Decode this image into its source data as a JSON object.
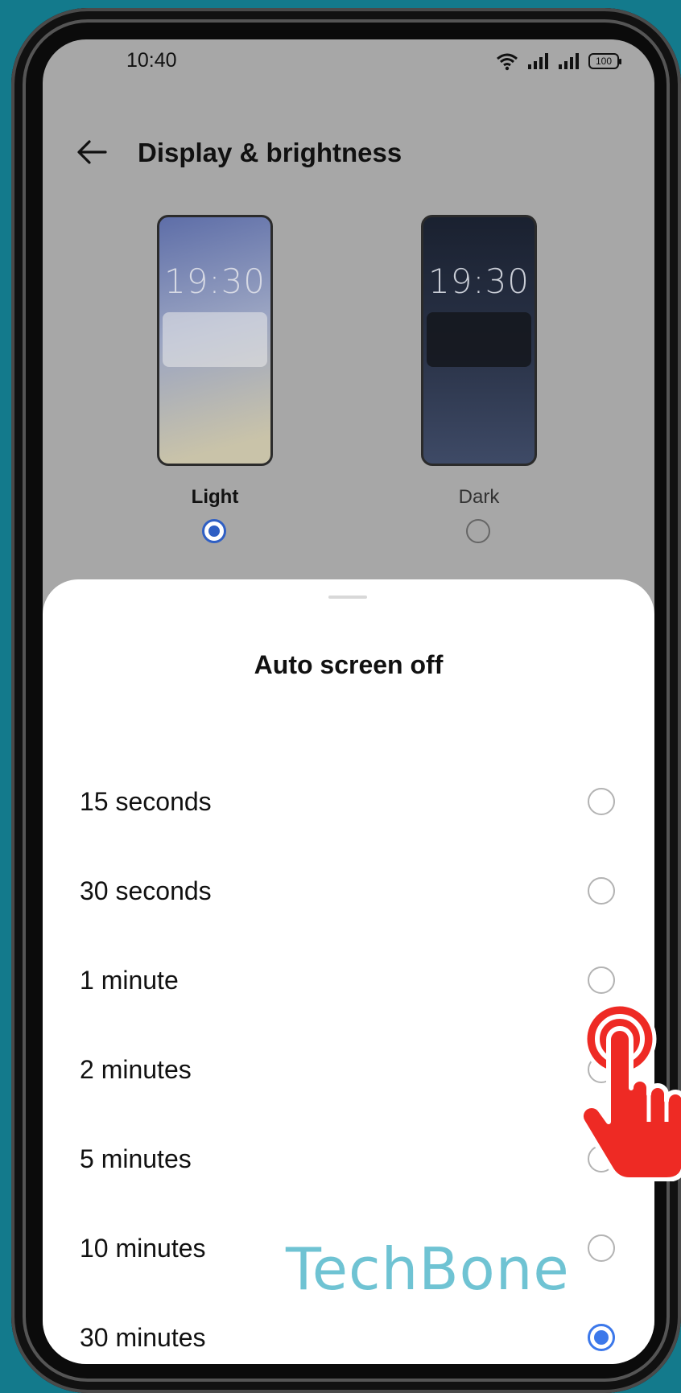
{
  "status_bar": {
    "time": "10:40",
    "battery": "100"
  },
  "header": {
    "title": "Display & brightness"
  },
  "themes": {
    "light": {
      "clock": "19:30",
      "label": "Light",
      "selected": true
    },
    "dark": {
      "clock": "19:30",
      "label": "Dark",
      "selected": false
    }
  },
  "sheet": {
    "title": "Auto screen off",
    "options": [
      {
        "label": "15 seconds",
        "selected": false
      },
      {
        "label": "30 seconds",
        "selected": false
      },
      {
        "label": "1 minute",
        "selected": false
      },
      {
        "label": "2 minutes",
        "selected": false
      },
      {
        "label": "5 minutes",
        "selected": false
      },
      {
        "label": "10 minutes",
        "selected": false
      },
      {
        "label": "30 minutes",
        "selected": true
      }
    ]
  },
  "watermark": "TechBone",
  "colors": {
    "accent": "#3c78ea",
    "tap_indicator": "#ee2a24",
    "background": "#137a8c"
  },
  "icons": [
    "back-arrow-icon",
    "wifi-icon",
    "signal-icon",
    "battery-icon",
    "tap-hand-icon"
  ]
}
